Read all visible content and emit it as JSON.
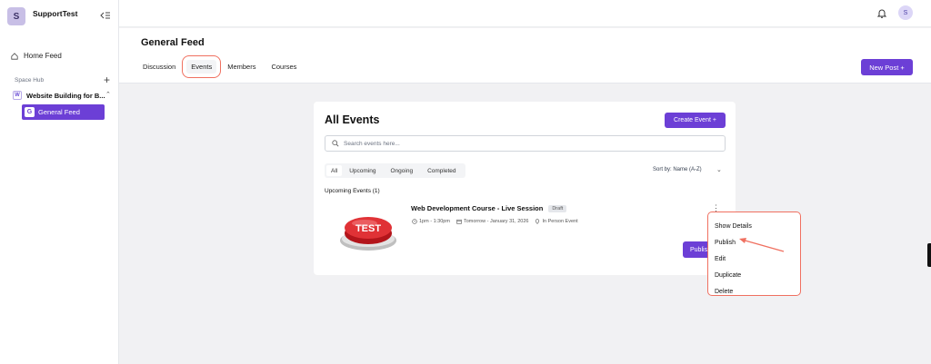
{
  "workspace": {
    "initial": "S",
    "name": "SupportTest"
  },
  "sidebar": {
    "home_feed": "Home Feed",
    "space_hub": "Space Hub",
    "space": {
      "badge": "W",
      "name": "Website Building for B..."
    },
    "active_feed": {
      "badge": "G",
      "name": "General Feed"
    }
  },
  "topbar": {
    "user_initial": "S"
  },
  "header": {
    "title": "General Feed",
    "tabs": [
      "Discussion",
      "Events",
      "Members",
      "Courses"
    ],
    "active_tab": "Events",
    "new_post": "New Post +"
  },
  "events": {
    "title": "All Events",
    "create_button": "Create Event +",
    "search_placeholder": "Search events here...",
    "filters": [
      "All",
      "Upcoming",
      "Ongoing",
      "Completed"
    ],
    "active_filter": "All",
    "sort": "Sort by: Name (A-Z)",
    "section_label": "Upcoming Events (1)",
    "event": {
      "image_text": "TEST",
      "title": "Web Development Course - Live Session",
      "status": "Draft",
      "time": "1pm - 1:30pm",
      "date": "Tomorrow - January 31, 2026",
      "location": "In Person Event",
      "publish_button": "Publish"
    }
  },
  "context_menu": {
    "items": [
      "Show Details",
      "Publish",
      "Edit",
      "Duplicate",
      "Delete"
    ]
  },
  "colors": {
    "accent": "#6c3fd6",
    "highlight": "#f07060"
  }
}
